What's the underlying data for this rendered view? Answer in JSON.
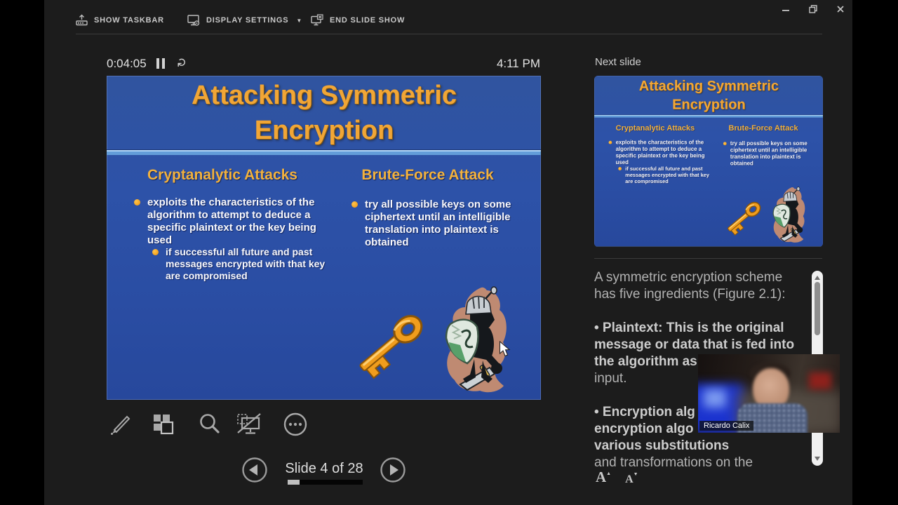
{
  "toolbar": {
    "show_taskbar": "SHOW TASKBAR",
    "display_settings": "DISPLAY SETTINGS",
    "display_caret": "▼",
    "end_slide_show": "END SLIDE SHOW"
  },
  "presenter": {
    "timer": "0:04:05",
    "clock": "4:11 PM",
    "slide_counter": "Slide 4 of 28",
    "progress_style": "width:16%"
  },
  "slide": {
    "title": "Attacking Symmetric Encryption",
    "columns": [
      {
        "heading": "Cryptanalytic Attacks",
        "bullet": "exploits the characteristics of the algorithm to attempt to deduce a specific plaintext or the key being used",
        "sub_bullet": "if successful all future and past messages encrypted with that key are compromised"
      },
      {
        "heading": "Brute-Force Attack",
        "bullet": "try all possible keys on some ciphertext until an intelligible translation into plaintext is obtained"
      }
    ],
    "clipart": [
      "gold-key",
      "knight-with-shield-and-sword"
    ]
  },
  "panel": {
    "next_slide_label": "Next slide"
  },
  "notes": {
    "lines": [
      {
        "text": "A symmetric encryption scheme",
        "bold": false
      },
      {
        "text": "has five ingredients (Figure 2.1):",
        "bold": false
      },
      {
        "text": "• Plaintext: This is the original",
        "bold": true
      },
      {
        "text": "message or data that is fed into",
        "bold": true
      },
      {
        "text": "the algorithm as",
        "bold": true
      },
      {
        "text": "input.",
        "bold": false
      },
      {
        "text": "• Encryption alg",
        "bold": true
      },
      {
        "text": "encryption algo",
        "bold": true
      },
      {
        "text": "various substitutions",
        "bold": true
      },
      {
        "text": "and transformations on the",
        "bold": false
      }
    ],
    "font_increase": "A",
    "increase_caret": "▲",
    "font_decrease": "A",
    "decrease_caret": "▼"
  },
  "webcam": {
    "name": "Ricardo Calix"
  },
  "colors": {
    "slide_bg": "#2c51a7",
    "accent_gold": "#f1a636",
    "divider_blue": "#639dd9",
    "bullet_orange": "#f39a12",
    "app_bg": "#1c1c1c"
  }
}
